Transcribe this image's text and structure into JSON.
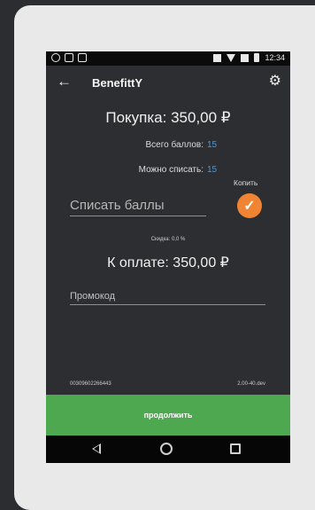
{
  "statusbar": {
    "time": "12:34"
  },
  "appbar": {
    "title": "BenefittY"
  },
  "purchase": {
    "label": "Покупка: 350,00 ₽"
  },
  "points": {
    "total_label": "Всего баллов:",
    "total_value": "15",
    "spendable_label": "Можно списать:",
    "spendable_value": "15"
  },
  "accumulate": {
    "label": "Копить",
    "checked": true,
    "color": "#f08433"
  },
  "spend_field": {
    "value": "Списать баллы"
  },
  "discount": {
    "label": "Скидка: 0,0 %"
  },
  "to_pay": {
    "label": "К оплате: 350,00 ₽"
  },
  "promo_field": {
    "placeholder": "Промокод"
  },
  "footer": {
    "device_id": "00309602266443",
    "version": "2.00-40.dev"
  },
  "continue_button": {
    "label": "продолжить",
    "color": "#4ea84f"
  }
}
